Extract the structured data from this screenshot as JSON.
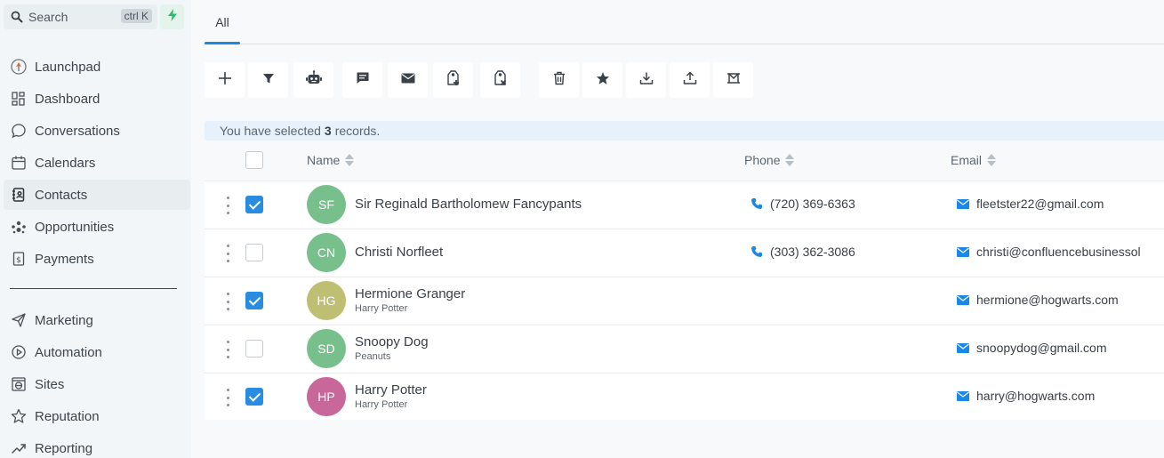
{
  "colors": {
    "accent": "#1b87e6",
    "checkbox_checked": "#2a8ce0",
    "avatar_green": "#78c08b",
    "avatar_olive": "#bfbf73",
    "avatar_pink": "#c7679a",
    "bolt_green": "#2bbf6a"
  },
  "sidebar": {
    "search": {
      "label": "Search",
      "shortcut": "ctrl K",
      "icon": "search-icon",
      "action_icon": "lightning-icon"
    },
    "items": [
      {
        "label": "Launchpad",
        "icon": "rocket-icon"
      },
      {
        "label": "Dashboard",
        "icon": "grid-icon"
      },
      {
        "label": "Conversations",
        "icon": "chat-bubble-icon"
      },
      {
        "label": "Calendars",
        "icon": "calendar-icon"
      },
      {
        "label": "Contacts",
        "icon": "contact-book-icon",
        "active": true
      },
      {
        "label": "Opportunities",
        "icon": "opportunities-icon"
      },
      {
        "label": "Payments",
        "icon": "payment-icon"
      },
      {
        "label": "Marketing",
        "icon": "send-icon"
      },
      {
        "label": "Automation",
        "icon": "automation-icon"
      },
      {
        "label": "Sites",
        "icon": "globe-icon"
      },
      {
        "label": "Reputation",
        "icon": "star-icon"
      },
      {
        "label": "Reporting",
        "icon": "trend-icon"
      }
    ]
  },
  "main": {
    "tabs": [
      {
        "label": "All",
        "active": true
      }
    ],
    "toolbar": [
      {
        "name": "add",
        "icon": "plus-icon"
      },
      {
        "name": "filter",
        "icon": "filter-icon"
      },
      {
        "name": "automation",
        "icon": "robot-icon"
      },
      {
        "name": "sms",
        "icon": "message-icon"
      },
      {
        "name": "email",
        "icon": "envelope-icon"
      },
      {
        "name": "add-tag",
        "icon": "tag-add-icon"
      },
      {
        "name": "remove-tag",
        "icon": "tag-remove-icon"
      },
      {
        "name": "delete",
        "icon": "trash-icon"
      },
      {
        "name": "review",
        "icon": "star-icon"
      },
      {
        "name": "import",
        "icon": "download-icon"
      },
      {
        "name": "export",
        "icon": "upload-icon"
      },
      {
        "name": "merge",
        "icon": "merge-icon"
      }
    ],
    "selection": {
      "prefix": "You have selected",
      "count": "3",
      "suffix": "records."
    },
    "table": {
      "columns": [
        {
          "label": "Name"
        },
        {
          "label": "Phone"
        },
        {
          "label": "Email"
        }
      ],
      "rows": [
        {
          "initials": "SF",
          "name": "Sir Reginald Bartholomew Fancypants",
          "sub": "",
          "phone": "(720) 369-6363",
          "email": "fleetster22@gmail.com",
          "checked": true,
          "avatar_color": "#78c08b"
        },
        {
          "initials": "CN",
          "name": "Christi Norfleet",
          "sub": "",
          "phone": "(303) 362-3086",
          "email": "christi@confluencebusinessol",
          "checked": false,
          "avatar_color": "#78c08b"
        },
        {
          "initials": "HG",
          "name": "Hermione Granger",
          "sub": "Harry Potter",
          "phone": "",
          "email": "hermione@hogwarts.com",
          "checked": true,
          "avatar_color": "#bfbf73"
        },
        {
          "initials": "SD",
          "name": "Snoopy Dog",
          "sub": "Peanuts",
          "phone": "",
          "email": "snoopydog@gmail.com",
          "checked": false,
          "avatar_color": "#78c08b"
        },
        {
          "initials": "HP",
          "name": "Harry Potter",
          "sub": "Harry Potter",
          "phone": "",
          "email": "harry@hogwarts.com",
          "checked": true,
          "avatar_color": "#c7679a"
        }
      ]
    }
  }
}
